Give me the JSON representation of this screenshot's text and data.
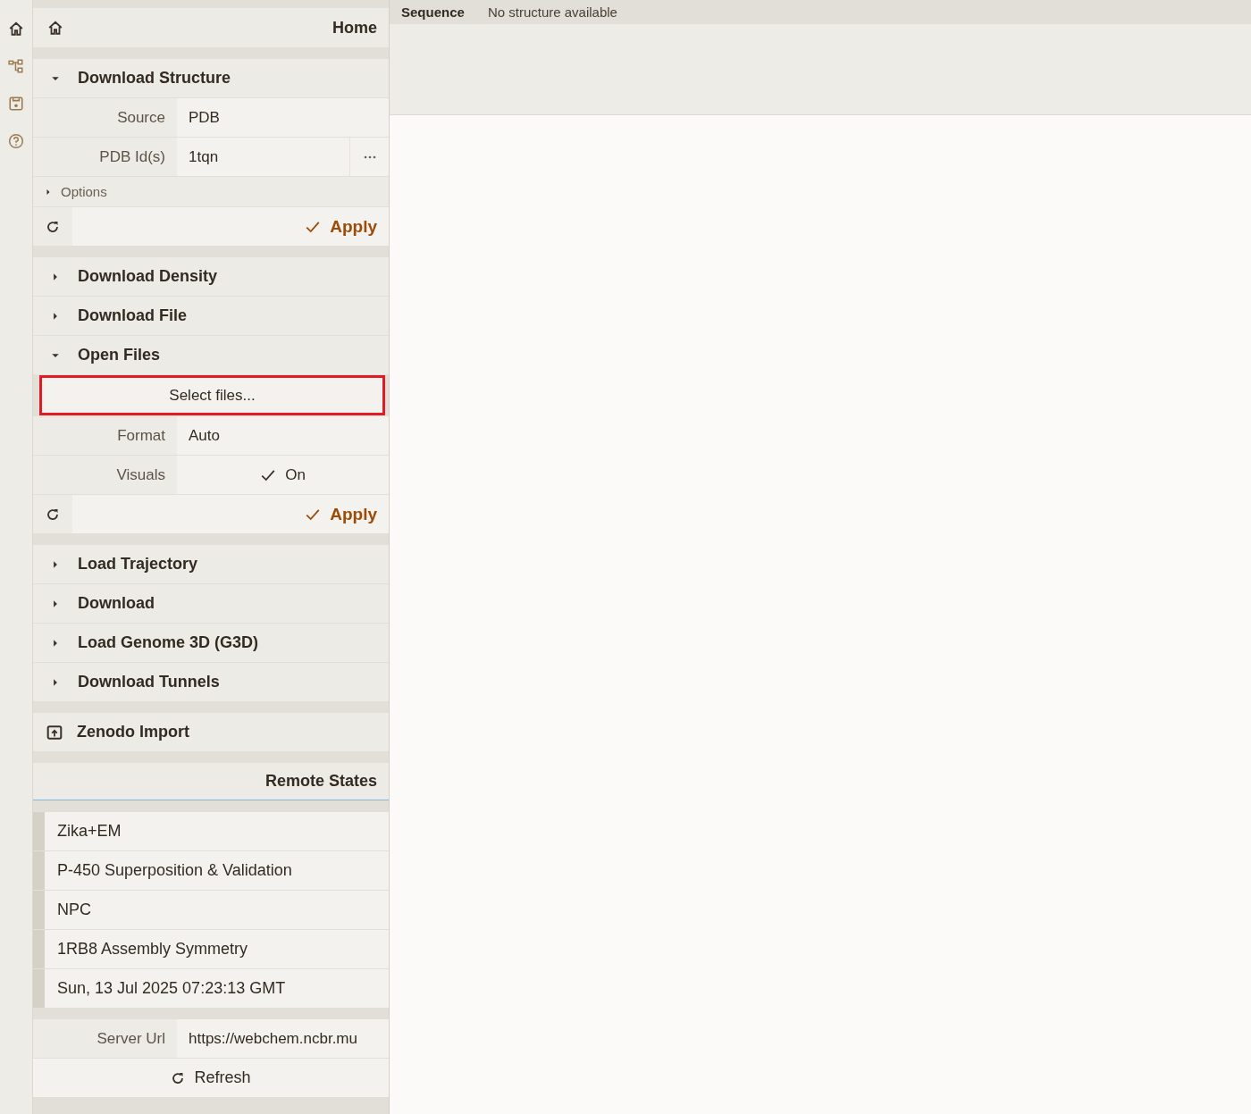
{
  "panel": {
    "home": {
      "title": "Home"
    },
    "groups": [
      {
        "items": [
          {
            "title": "Download Structure",
            "expanded": true,
            "body": {
              "fields": [
                {
                  "kind": "select",
                  "label": "Source",
                  "value": "PDB"
                },
                {
                  "kind": "text_more",
                  "label": "PDB Id(s)",
                  "value": "1tqn"
                }
              ],
              "options": {
                "label": "Options",
                "expanded": false
              },
              "apply": "Apply"
            }
          }
        ]
      },
      {
        "items": [
          {
            "title": "Download Density",
            "expanded": false
          },
          {
            "title": "Download File",
            "expanded": false
          },
          {
            "title": "Open Files",
            "expanded": true,
            "body": {
              "file_button": {
                "label": "Select files...",
                "highlighted": true
              },
              "fields": [
                {
                  "kind": "select",
                  "label": "Format",
                  "value": "Auto"
                },
                {
                  "kind": "toggle",
                  "label": "Visuals",
                  "value": "On",
                  "on": true
                }
              ],
              "apply": "Apply"
            }
          }
        ]
      },
      {
        "items": [
          {
            "title": "Load Trajectory",
            "expanded": false
          },
          {
            "title": "Download",
            "expanded": false
          },
          {
            "title": "Load Genome 3D (G3D)",
            "expanded": false
          },
          {
            "title": "Download Tunnels",
            "expanded": false
          }
        ]
      }
    ],
    "zenodo": {
      "title": "Zenodo Import"
    },
    "remote_states": {
      "title": "Remote States",
      "entries": [
        "Zika+EM",
        "P-450 Superposition & Validation",
        "NPC",
        "1RB8 Assembly Symmetry",
        "Sun, 13 Jul 2025 07:23:13 GMT"
      ],
      "server_url": {
        "label": "Server Url",
        "value": "https://webchem.ncbr.mu"
      },
      "refresh": "Refresh"
    }
  },
  "sequence": {
    "label": "Sequence",
    "message": "No structure available"
  }
}
